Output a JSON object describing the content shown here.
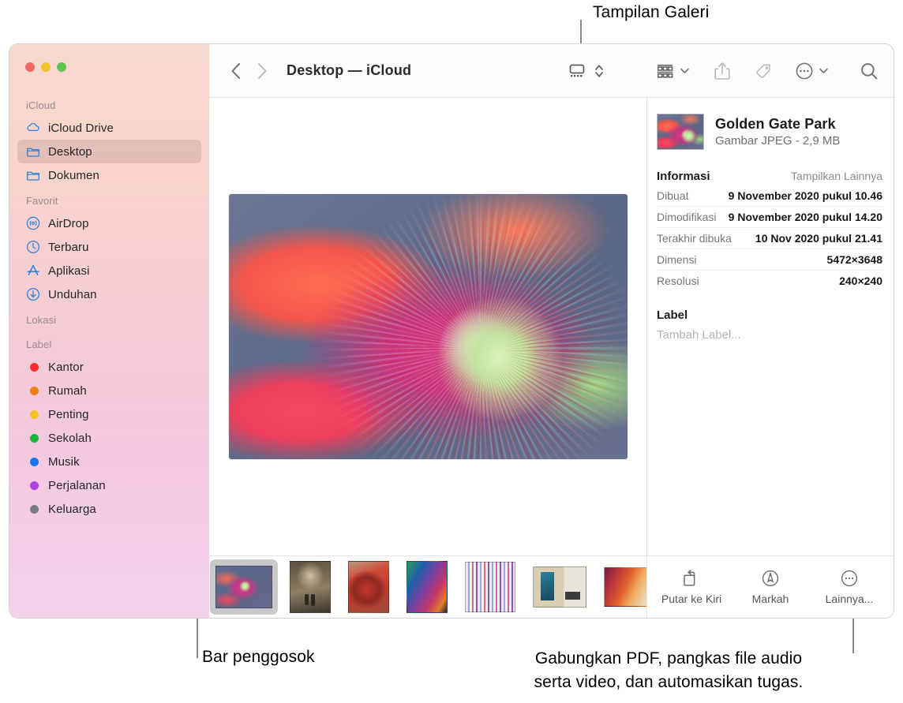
{
  "annotations": {
    "gallery_view": "Tampilan Galeri",
    "scrubber_bar": "Bar penggosok",
    "actions_line1": "Gabungkan PDF, pangkas file audio",
    "actions_line2": "serta video, dan automasikan tugas."
  },
  "window": {
    "traffic_lights": [
      "close-button",
      "minimize-button",
      "zoom-button"
    ]
  },
  "toolbar": {
    "back": "back-icon",
    "forward": "forward-icon",
    "title": "Desktop — iCloud",
    "view_gallery": "gallery-view-icon",
    "view_chevron": "updown-chevron-icon",
    "group": "group-items-icon",
    "share": "share-icon",
    "tag": "tag-icon",
    "more": "more-ellipsis-icon",
    "search": "search-icon"
  },
  "sidebar": {
    "sections": [
      {
        "header": "iCloud",
        "items": [
          {
            "label": "iCloud Drive",
            "icon": "cloud-icon",
            "selected": false
          },
          {
            "label": "Desktop",
            "icon": "folder-icon",
            "selected": true
          },
          {
            "label": "Dokumen",
            "icon": "folder-icon",
            "selected": false
          }
        ]
      },
      {
        "header": "Favorit",
        "items": [
          {
            "label": "AirDrop",
            "icon": "airdrop-icon",
            "selected": false
          },
          {
            "label": "Terbaru",
            "icon": "clock-icon",
            "selected": false
          },
          {
            "label": "Aplikasi",
            "icon": "applications-icon",
            "selected": false
          },
          {
            "label": "Unduhan",
            "icon": "downloads-icon",
            "selected": false
          }
        ]
      },
      {
        "header": "Lokasi",
        "items": []
      },
      {
        "header": "Label",
        "items": [
          {
            "label": "Kantor",
            "icon": "tag-dot-icon",
            "color": "#fa2c32"
          },
          {
            "label": "Rumah",
            "icon": "tag-dot-icon",
            "color": "#ec8013"
          },
          {
            "label": "Penting",
            "icon": "tag-dot-icon",
            "color": "#f5c024"
          },
          {
            "label": "Sekolah",
            "icon": "tag-dot-icon",
            "color": "#1bb83c"
          },
          {
            "label": "Musik",
            "icon": "tag-dot-icon",
            "color": "#1577ef"
          },
          {
            "label": "Perjalanan",
            "icon": "tag-dot-icon",
            "color": "#b141e0"
          },
          {
            "label": "Keluarga",
            "icon": "tag-dot-icon",
            "color": "#7b7b80"
          }
        ]
      }
    ]
  },
  "preview": {
    "image": "coneflower-macro-photo"
  },
  "scrubber": {
    "thumbnails": [
      {
        "name": "coneflower-photo",
        "selected": true
      },
      {
        "name": "forest-path-photo",
        "selected": false
      },
      {
        "name": "red-hands-photo",
        "selected": false
      },
      {
        "name": "neon-portrait-photo",
        "selected": false
      },
      {
        "name": "striped-curtain-photo",
        "selected": false
      },
      {
        "name": "louisa-farris-poster",
        "selected": false
      },
      {
        "name": "gradient-artwork",
        "selected": false
      },
      {
        "name": "marketing-plan-fall-2019-doc",
        "selected": false
      }
    ]
  },
  "info": {
    "file_name": "Golden Gate Park",
    "file_kind": "Gambar JPEG - 2,9 MB",
    "section_title": "Informasi",
    "section_action": "Tampilkan Lainnya",
    "metadata": [
      {
        "key": "Dibuat",
        "value": "9 November 2020 pukul 10.46"
      },
      {
        "key": "Dimodifikasi",
        "value": "9 November 2020 pukul 14.20"
      },
      {
        "key": "Terakhir dibuka",
        "value": "10 Nov 2020 pukul 21.41"
      },
      {
        "key": "Dimensi",
        "value": "5472×3648"
      },
      {
        "key": "Resolusi",
        "value": "240×240"
      }
    ],
    "label_title": "Label",
    "label_add": "Tambah Label...",
    "actions": [
      {
        "label": "Putar ke Kiri",
        "icon": "rotate-left-icon"
      },
      {
        "label": "Markah",
        "icon": "markup-pen-icon"
      },
      {
        "label": "Lainnya...",
        "icon": "more-ellipsis-icon"
      }
    ]
  }
}
